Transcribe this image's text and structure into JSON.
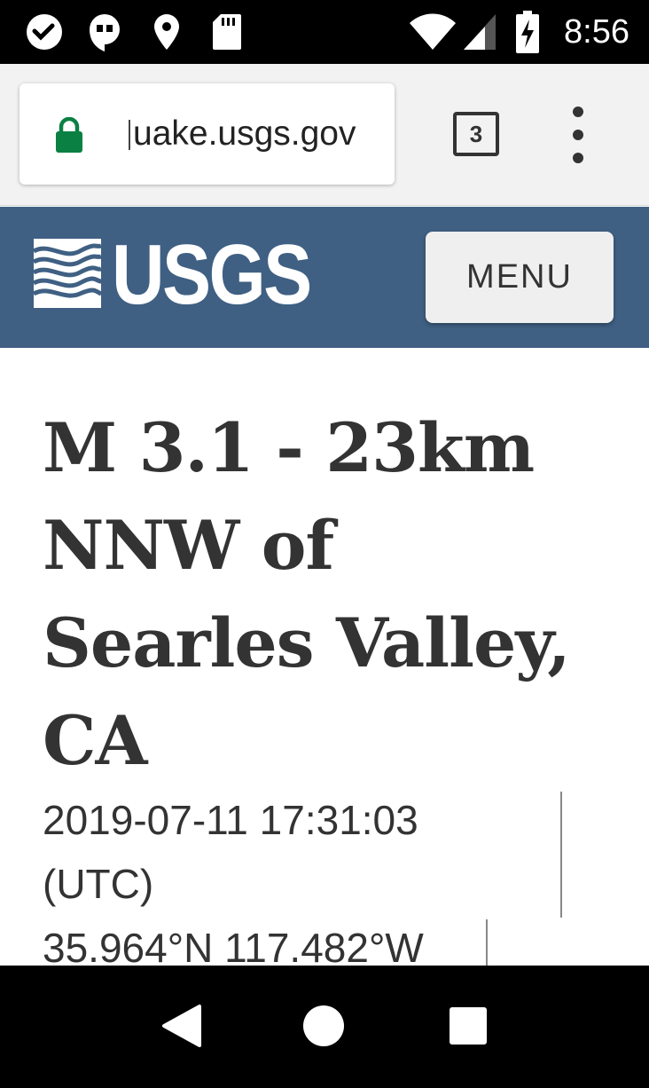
{
  "status_bar": {
    "icons": [
      "missed-call-icon",
      "hangouts-icon",
      "location-icon",
      "sd-card-icon",
      "wifi-icon",
      "signal-icon",
      "battery-charging-icon"
    ],
    "time": "8:56"
  },
  "browser": {
    "url": "uake.usgs.gov",
    "tab_count": "3",
    "secure": true,
    "lock_color": "#0b8043"
  },
  "site_header": {
    "logo_text": "USGS",
    "menu_label": "MENU",
    "background_color": "#3f6083"
  },
  "event": {
    "title": "M 3.1 - 23km NNW of Searles Valley, CA",
    "time_line1": "2019-07-11 17:31:03",
    "time_line2": "(UTC)",
    "coordinates": "35.964°N 117.482°W"
  },
  "nav_bar": {
    "buttons": [
      "back-icon",
      "home-icon",
      "recents-icon"
    ]
  }
}
